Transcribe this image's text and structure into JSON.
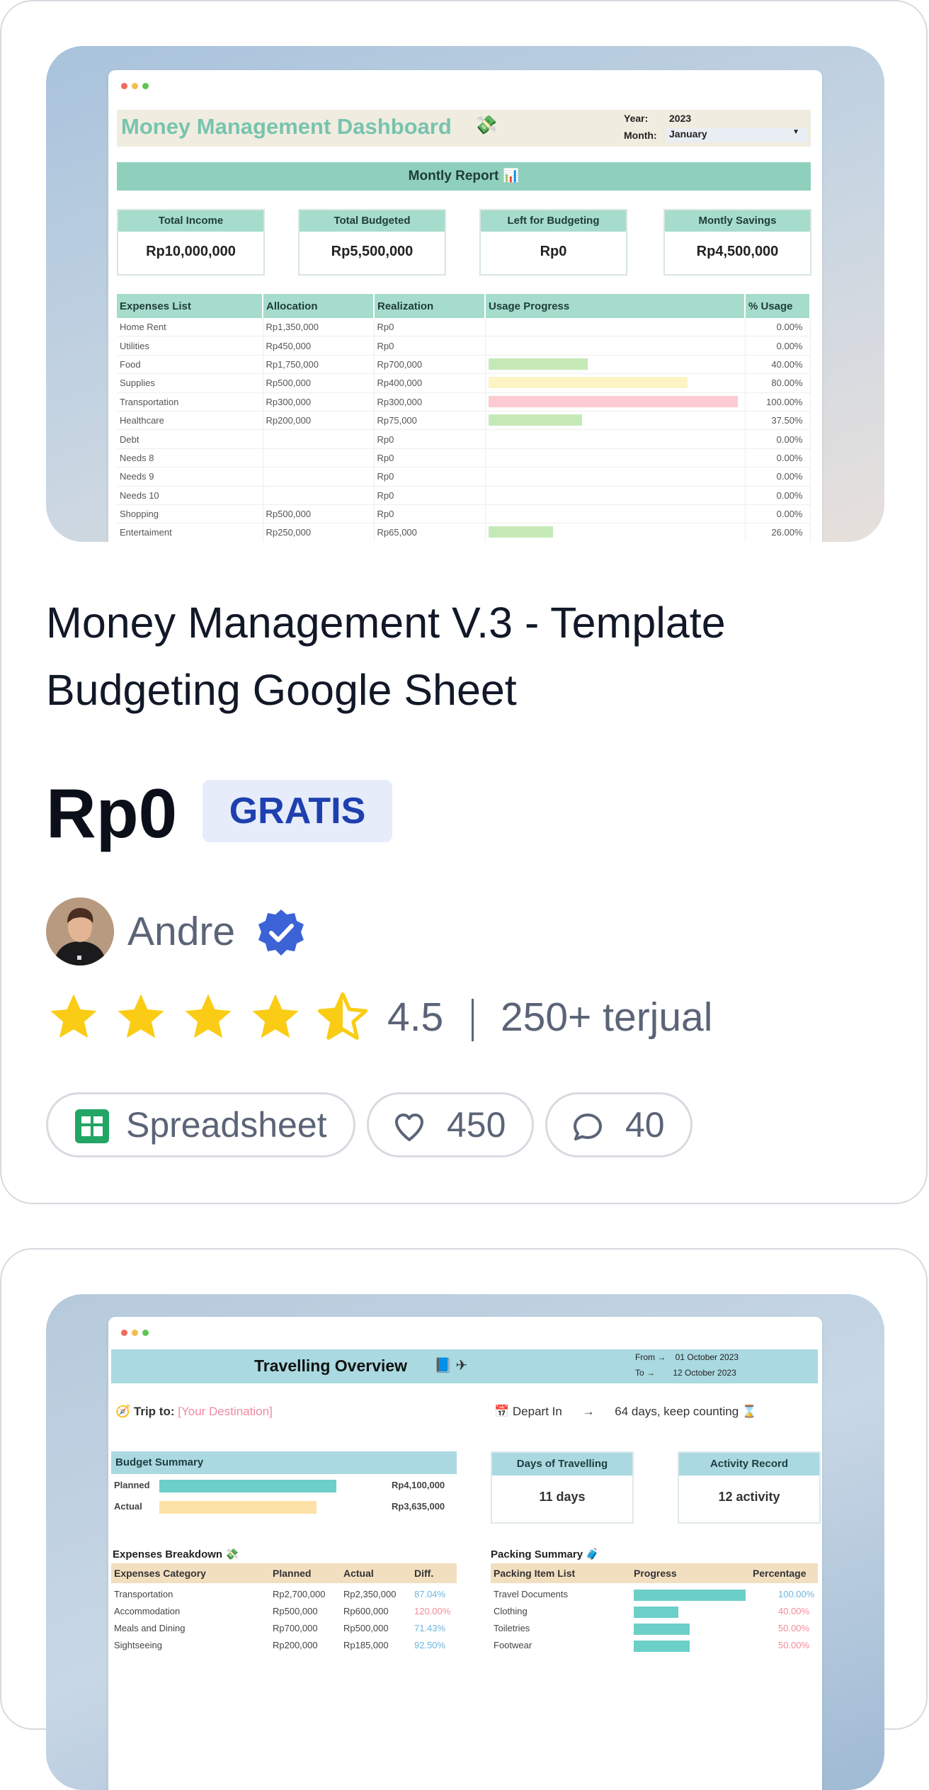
{
  "card1": {
    "thumbnail": {
      "dashboard_title": "Money Management Dashboard",
      "year_label": "Year:",
      "year_value": "2023",
      "month_label": "Month:",
      "month_value": "January",
      "report_title": "Montly Report",
      "kpis": [
        {
          "label": "Total Income",
          "value": "Rp10,000,000"
        },
        {
          "label": "Total Budgeted",
          "value": "Rp5,500,000"
        },
        {
          "label": "Left for Budgeting",
          "value": "Rp0"
        },
        {
          "label": "Montly Savings",
          "value": "Rp4,500,000"
        }
      ],
      "table_headers": [
        "Expenses List",
        "Allocation",
        "Realization",
        "Usage Progress",
        "% Usage"
      ],
      "rows": [
        {
          "name": "Home Rent",
          "allocation": "Rp1,350,000",
          "realization": "Rp0",
          "usage": 0,
          "pct": "0.00%"
        },
        {
          "name": "Utilities",
          "allocation": "Rp450,000",
          "realization": "Rp0",
          "usage": 0,
          "pct": "0.00%"
        },
        {
          "name": "Food",
          "allocation": "Rp1,750,000",
          "realization": "Rp700,000",
          "usage": 0.4,
          "pct": "40.00%"
        },
        {
          "name": "Supplies",
          "allocation": "Rp500,000",
          "realization": "Rp400,000",
          "usage": 0.8,
          "pct": "80.00%"
        },
        {
          "name": "Transportation",
          "allocation": "Rp300,000",
          "realization": "Rp300,000",
          "usage": 1.0,
          "pct": "100.00%"
        },
        {
          "name": "Healthcare",
          "allocation": "Rp200,000",
          "realization": "Rp75,000",
          "usage": 0.375,
          "pct": "37.50%"
        },
        {
          "name": "Debt",
          "allocation": "",
          "realization": "Rp0",
          "usage": 0,
          "pct": "0.00%"
        },
        {
          "name": "Needs 8",
          "allocation": "",
          "realization": "Rp0",
          "usage": 0,
          "pct": "0.00%"
        },
        {
          "name": "Needs 9",
          "allocation": "",
          "realization": "Rp0",
          "usage": 0,
          "pct": "0.00%"
        },
        {
          "name": "Needs 10",
          "allocation": "",
          "realization": "Rp0",
          "usage": 0,
          "pct": "0.00%"
        },
        {
          "name": "Shopping",
          "allocation": "Rp500,000",
          "realization": "Rp0",
          "usage": 0,
          "pct": "0.00%"
        },
        {
          "name": "Entertaiment",
          "allocation": "Rp250,000",
          "realization": "Rp65,000",
          "usage": 0.26,
          "pct": "26.00%"
        }
      ]
    },
    "title": "Money Management V.3 - Template Budgeting Google Sheet",
    "price": "Rp0",
    "badge": "GRATIS",
    "author": "Andre",
    "rating": {
      "value": 4.5,
      "text": "4.5",
      "sold": "250+ terjual"
    },
    "tags": {
      "type": "Spreadsheet",
      "likes": "450",
      "comments": "40"
    },
    "icons": {
      "verified": "verified-badge-icon",
      "heart": "heart-icon",
      "comment": "comment-icon",
      "sheet": "google-sheets-icon",
      "star": "star-icon"
    },
    "colors": {
      "accent": "#1e40af",
      "badge_bg": "#e6ecf9",
      "star": "#facc15",
      "verified": "#3b63d6"
    }
  },
  "card2": {
    "thumbnail": {
      "title": "Travelling Overview",
      "from_label": "From",
      "from_value": "01 October 2023",
      "to_label": "To",
      "to_value": "12 October 2023",
      "trip_label": "Trip to:",
      "trip_value": "[Your Destination]",
      "depart_label": "Depart In",
      "depart_value": "64 days, keep counting",
      "budget_title": "Budget Summary",
      "planned_label": "Planned",
      "planned_value": "Rp4,100,000",
      "actual_label": "Actual",
      "actual_value": "Rp3,635,000",
      "days_title": "Days of Travelling",
      "days_value": "11 days",
      "activity_title": "Activity Record",
      "activity_value": "12 activity",
      "expenses_title": "Expenses Breakdown",
      "expenses_headers": [
        "Expenses Category",
        "Planned",
        "Actual",
        "Diff."
      ],
      "expenses_rows": [
        {
          "cat": "Transportation",
          "planned": "Rp2,700,000",
          "actual": "Rp2,350,000",
          "diff": "87.04%"
        },
        {
          "cat": "Accommodation",
          "planned": "Rp500,000",
          "actual": "Rp600,000",
          "diff": "120.00%"
        },
        {
          "cat": "Meals and Dining",
          "planned": "Rp700,000",
          "actual": "Rp500,000",
          "diff": "71.43%"
        },
        {
          "cat": "Sightseeing",
          "planned": "Rp200,000",
          "actual": "Rp185,000",
          "diff": "92.50%"
        }
      ],
      "packing_title": "Packing Summary",
      "packing_headers": [
        "Packing Item List",
        "Progress",
        "Percentage"
      ],
      "packing_rows": [
        {
          "item": "Travel Documents",
          "progress": 1.0,
          "pct": "100.00%"
        },
        {
          "item": "Clothing",
          "progress": 0.4,
          "pct": "40.00%"
        },
        {
          "item": "Toiletries",
          "progress": 0.5,
          "pct": "50.00%"
        },
        {
          "item": "Footwear",
          "progress": 0.5,
          "pct": "50.00%"
        }
      ]
    }
  }
}
